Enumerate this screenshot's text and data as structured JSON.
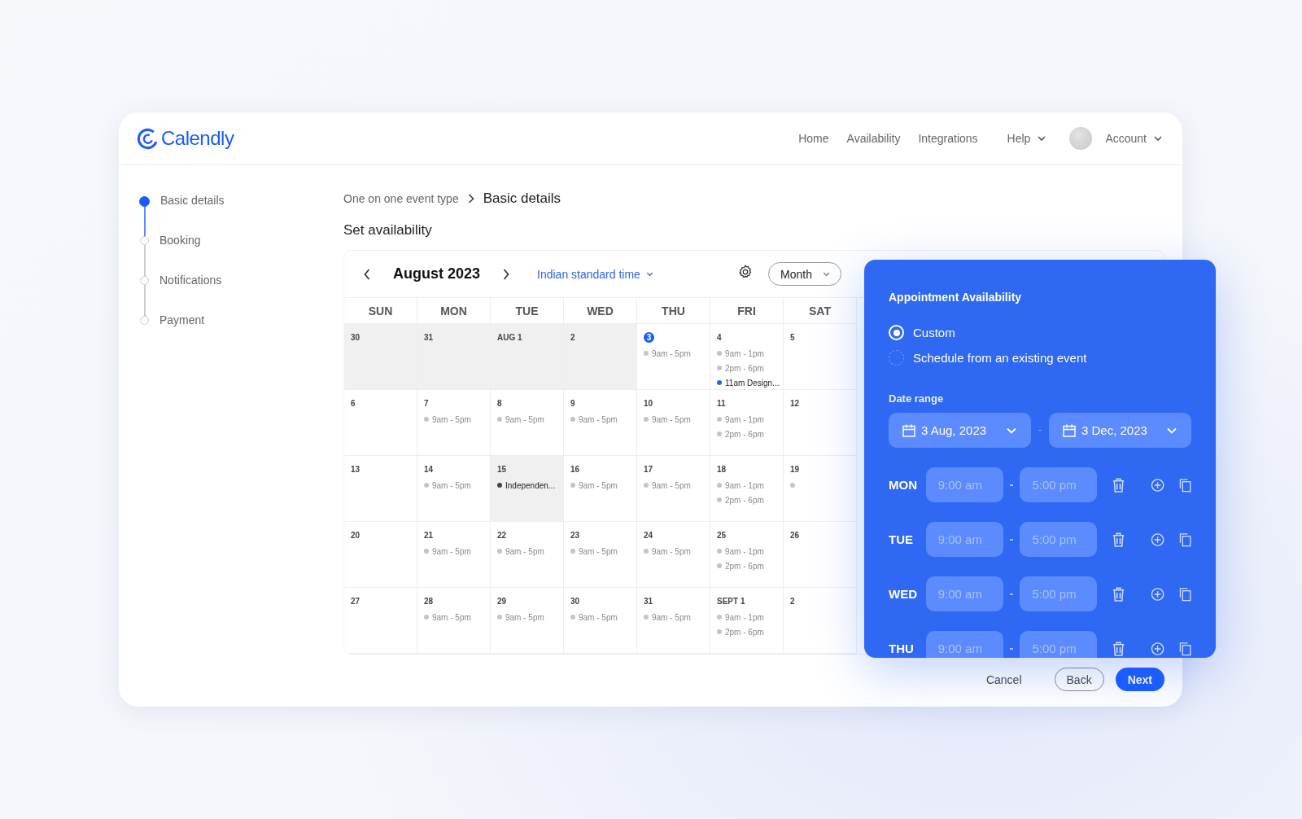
{
  "brand": {
    "name": "Calendly"
  },
  "nav": [
    {
      "label": "Home",
      "kind": "link"
    },
    {
      "label": "Availability",
      "kind": "link"
    },
    {
      "label": "Integrations",
      "kind": "link"
    },
    {
      "label": "Help",
      "kind": "menu"
    },
    {
      "label": "Account",
      "kind": "account"
    }
  ],
  "steps": [
    {
      "label": "Basic details",
      "selected": true
    },
    {
      "label": "Booking",
      "selected": false
    },
    {
      "label": "Notifications",
      "selected": false
    },
    {
      "label": "Payment",
      "selected": false
    }
  ],
  "breadcrumb": [
    "One on one event type",
    "Basic details"
  ],
  "section_title": "Set availability",
  "calendar": {
    "month": "August 2023",
    "timezone": "Indian standard time",
    "view": "Month",
    "weekdays": [
      "SUN",
      "MON",
      "TUE",
      "WED",
      "THU",
      "FRI",
      "SAT"
    ],
    "weeks": [
      [
        {
          "date": "30",
          "shaded": true,
          "today": false
        },
        {
          "date": "31",
          "shaded": true,
          "today": false
        },
        {
          "date": "AUG 1",
          "shaded": true,
          "today": false
        },
        {
          "date": "2",
          "shaded": true,
          "today": false
        },
        {
          "date": "3",
          "shaded": false,
          "today": true,
          "events": [
            {
              "text": "9am - 5pm",
              "color": "#c4c4c4"
            }
          ]
        },
        {
          "date": "4",
          "shaded": false,
          "today": false,
          "events": [
            {
              "text": "9am - 1pm",
              "color": "#c4c4c4"
            },
            {
              "text": "2pm - 6pm",
              "color": "#c4c4c4"
            },
            {
              "text": "11am Design...",
              "color": "#2f64f0"
            }
          ]
        },
        {
          "date": "5",
          "shaded": false,
          "today": false
        }
      ],
      [
        {
          "date": "6",
          "shaded": false,
          "today": false
        },
        {
          "date": "7",
          "shaded": false,
          "today": false,
          "events": [
            {
              "text": "9am - 5pm",
              "color": "#c4c4c4"
            }
          ]
        },
        {
          "date": "8",
          "shaded": false,
          "today": false,
          "events": [
            {
              "text": "9am - 5pm",
              "color": "#c4c4c4"
            }
          ]
        },
        {
          "date": "9",
          "shaded": false,
          "today": false,
          "events": [
            {
              "text": "9am - 5pm",
              "color": "#c4c4c4"
            }
          ]
        },
        {
          "date": "10",
          "shaded": false,
          "today": false,
          "events": [
            {
              "text": "9am - 5pm",
              "color": "#c4c4c4"
            }
          ]
        },
        {
          "date": "11",
          "shaded": false,
          "today": false,
          "events": [
            {
              "text": "9am - 1pm",
              "color": "#c4c4c4"
            },
            {
              "text": "2pm - 6pm",
              "color": "#c4c4c4"
            }
          ]
        },
        {
          "date": "12",
          "shaded": false,
          "today": false
        }
      ],
      [
        {
          "date": "13",
          "shaded": false,
          "today": false
        },
        {
          "date": "14",
          "shaded": false,
          "today": false,
          "events": [
            {
              "text": "9am - 5pm",
              "color": "#c4c4c4"
            }
          ]
        },
        {
          "date": "15",
          "shaded": true,
          "today": false,
          "events": [
            {
              "text": "Independen...",
              "color": "#444444"
            }
          ]
        },
        {
          "date": "16",
          "shaded": false,
          "today": false,
          "events": [
            {
              "text": "9am - 5pm",
              "color": "#c4c4c4"
            }
          ]
        },
        {
          "date": "17",
          "shaded": false,
          "today": false,
          "events": [
            {
              "text": "9am - 5pm",
              "color": "#c4c4c4"
            }
          ]
        },
        {
          "date": "18",
          "shaded": false,
          "today": false,
          "events": [
            {
              "text": "9am - 1pm",
              "color": "#c4c4c4"
            },
            {
              "text": "2pm - 6pm",
              "color": "#c4c4c4"
            }
          ]
        },
        {
          "date": "19",
          "shaded": false,
          "today": false,
          "events": [
            {
              "color": "#c4c4c4"
            }
          ]
        }
      ],
      [
        {
          "date": "20",
          "shaded": false,
          "today": false
        },
        {
          "date": "21",
          "shaded": false,
          "today": false,
          "events": [
            {
              "text": "9am - 5pm",
              "color": "#c4c4c4"
            }
          ]
        },
        {
          "date": "22",
          "shaded": false,
          "today": false,
          "events": [
            {
              "text": "9am - 5pm",
              "color": "#c4c4c4"
            }
          ]
        },
        {
          "date": "23",
          "shaded": false,
          "today": false,
          "events": [
            {
              "text": "9am - 5pm",
              "color": "#c4c4c4"
            }
          ]
        },
        {
          "date": "24",
          "shaded": false,
          "today": false,
          "events": [
            {
              "text": "9am - 5pm",
              "color": "#c4c4c4"
            }
          ]
        },
        {
          "date": "25",
          "shaded": false,
          "today": false,
          "events": [
            {
              "text": "9am - 1pm",
              "color": "#c4c4c4"
            },
            {
              "text": "2pm - 6pm",
              "color": "#c4c4c4"
            }
          ]
        },
        {
          "date": "26",
          "shaded": false,
          "today": false
        }
      ],
      [
        {
          "date": "27",
          "shaded": false,
          "today": false
        },
        {
          "date": "28",
          "shaded": false,
          "today": false,
          "events": [
            {
              "text": "9am - 5pm",
              "color": "#c4c4c4"
            }
          ]
        },
        {
          "date": "29",
          "shaded": false,
          "today": false,
          "events": [
            {
              "text": "9am - 5pm",
              "color": "#c4c4c4"
            }
          ]
        },
        {
          "date": "30",
          "shaded": false,
          "today": false,
          "events": [
            {
              "text": "9am - 5pm",
              "color": "#c4c4c4"
            }
          ]
        },
        {
          "date": "31",
          "shaded": false,
          "today": false,
          "events": [
            {
              "text": "9am - 5pm",
              "color": "#c4c4c4"
            }
          ]
        },
        {
          "date": "SEPT 1",
          "shaded": false,
          "today": false,
          "events": [
            {
              "text": "9am - 1pm",
              "color": "#c4c4c4"
            },
            {
              "text": "2pm - 6pm",
              "color": "#c4c4c4"
            }
          ]
        },
        {
          "date": "2",
          "shaded": false,
          "today": false
        }
      ]
    ]
  },
  "availability_panel": {
    "title": "Appointment Availability",
    "options": [
      {
        "label": "Custom",
        "selected": true
      },
      {
        "label": "Schedule from an existing event",
        "selected": false
      }
    ],
    "date_range": {
      "label": "Date range",
      "from": "3 Aug, 2023",
      "to": "3 Dec, 2023"
    },
    "days": [
      {
        "day": "MON",
        "start": {
          "placeholder": "9:00 am"
        },
        "end": {
          "placeholder": "5:00 pm"
        }
      },
      {
        "day": "TUE",
        "start": {
          "placeholder": "9:00 am"
        },
        "end": {
          "placeholder": "5:00 pm"
        }
      },
      {
        "day": "WED",
        "start": {
          "placeholder": "9:00 am"
        },
        "end": {
          "placeholder": "5:00 pm"
        }
      },
      {
        "day": "THU",
        "start": {
          "placeholder": "9:00 am"
        },
        "end": {
          "placeholder": "5:00 pm"
        }
      }
    ]
  },
  "footer_buttons": [
    {
      "label": "Cancel",
      "kind": "text"
    },
    {
      "label": "Back",
      "kind": "outline"
    },
    {
      "label": "Next",
      "kind": "primary"
    }
  ]
}
